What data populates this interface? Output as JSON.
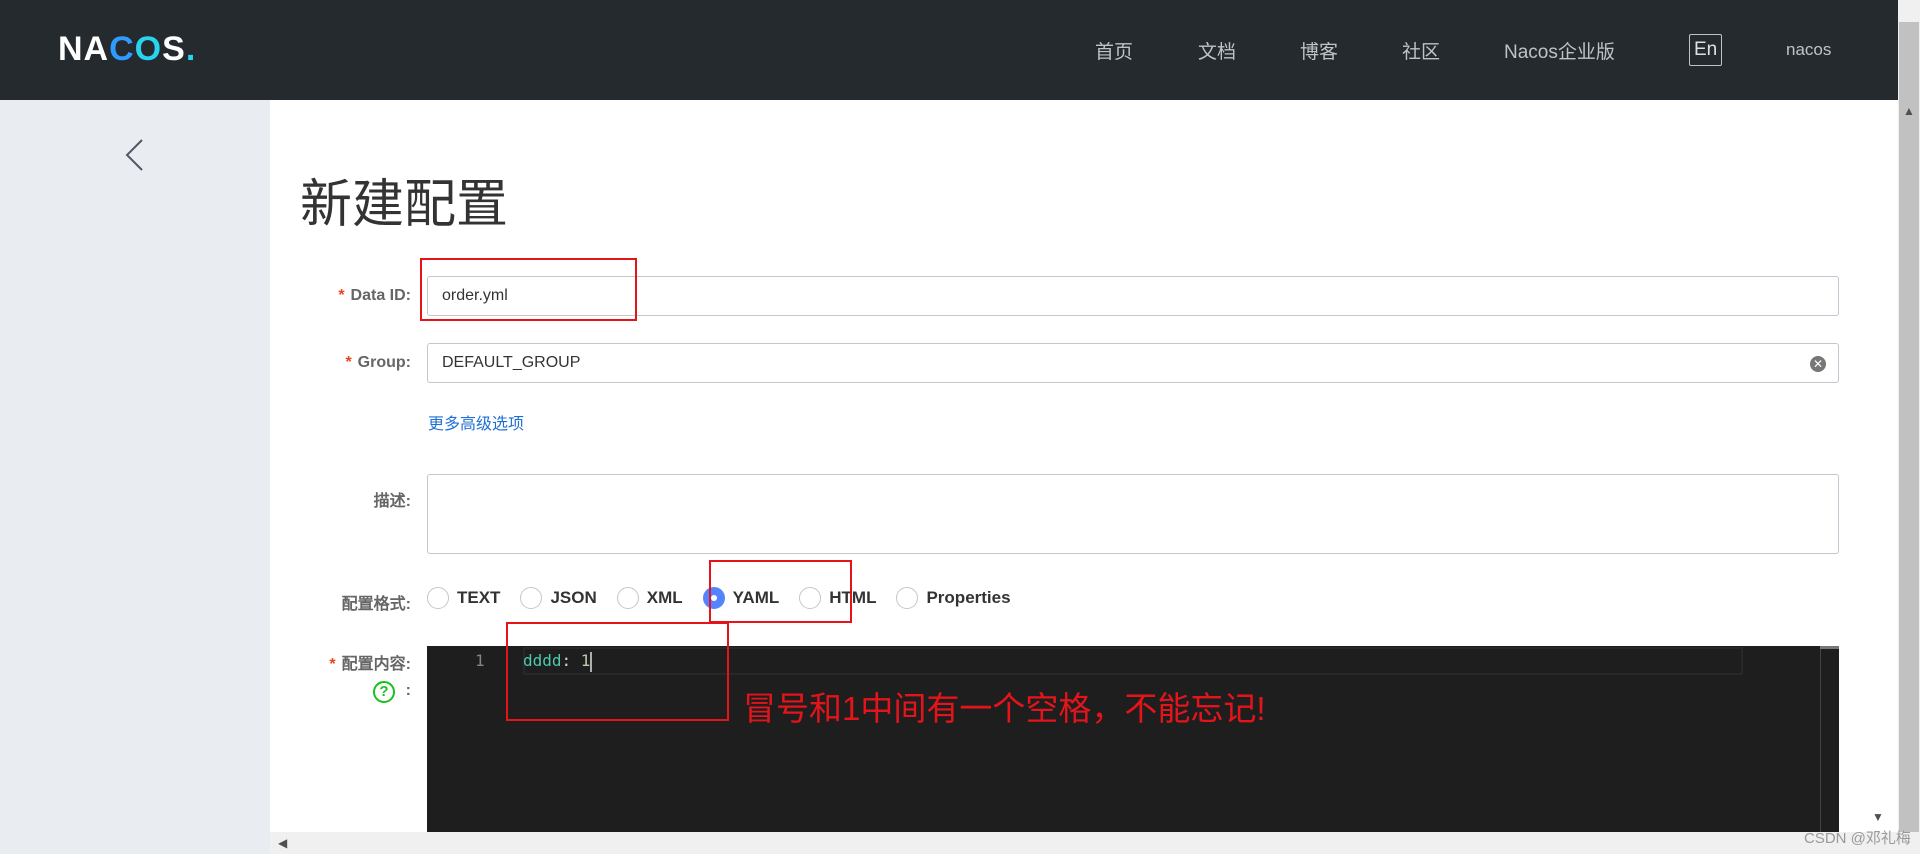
{
  "header": {
    "logo": "NACOS.",
    "logo_parts": [
      "NA",
      "C",
      "O",
      "S",
      "."
    ],
    "nav": [
      "首页",
      "文档",
      "博客",
      "社区",
      "Nacos企业版"
    ],
    "lang": "En",
    "user": "nacos"
  },
  "page": {
    "title": "新建配置"
  },
  "form": {
    "data_id": {
      "label": "Data ID:",
      "value": "order.yml"
    },
    "group": {
      "label": "Group:",
      "value": "DEFAULT_GROUP"
    },
    "advanced_link": "更多高级选项",
    "description": {
      "label": "描述:",
      "value": ""
    },
    "format": {
      "label": "配置格式:",
      "options": [
        "TEXT",
        "JSON",
        "XML",
        "YAML",
        "HTML",
        "Properties"
      ],
      "selected": "YAML"
    },
    "content": {
      "label": "配置内容:",
      "help_suffix": ":",
      "line_number": "1",
      "code_key": "dddd",
      "code_sep": ": ",
      "code_value": "1"
    }
  },
  "annotation": "冒号和1中间有一个空格，不能忘记!",
  "watermark": "CSDN @邓礼梅",
  "colors": {
    "header": "#252a2f",
    "accent": "#5584ff",
    "annotation": "#e5141b"
  }
}
